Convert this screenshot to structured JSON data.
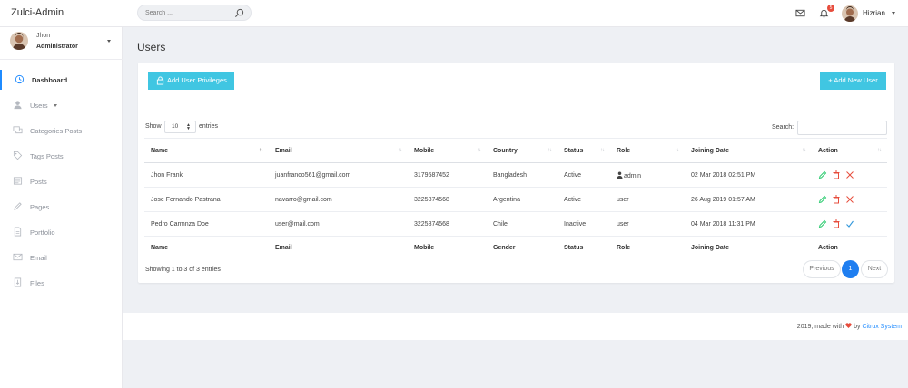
{
  "app": {
    "title": "Zulci-Admin"
  },
  "topbar": {
    "search_placeholder": "Search ...",
    "notification_count": "5",
    "user_name": "Hizrian"
  },
  "sidebar": {
    "profile": {
      "name": "Jhon",
      "role": "Administrator"
    },
    "items": [
      {
        "label": "Dashboard",
        "icon": "clock-icon",
        "active": true
      },
      {
        "label": "Users",
        "icon": "user-icon"
      },
      {
        "label": "Categories Posts",
        "icon": "chat-icon"
      },
      {
        "label": "Tags Posts",
        "icon": "tag-icon"
      },
      {
        "label": "Posts",
        "icon": "posts-icon"
      },
      {
        "label": "Pages",
        "icon": "pencil-icon"
      },
      {
        "label": "Portfolio",
        "icon": "document-icon"
      },
      {
        "label": "Email",
        "icon": "mail-icon"
      },
      {
        "label": "Files",
        "icon": "download-file-icon"
      }
    ]
  },
  "page": {
    "title": "Users"
  },
  "toolbar": {
    "add_privileges": "Add User Privileges",
    "add_user": "+ Add New User"
  },
  "table_controls": {
    "show_label": "Show",
    "page_size": "10",
    "entries_label": "entries",
    "search_label": "Search:"
  },
  "table": {
    "headers": [
      "Name",
      "Email",
      "Mobile",
      "Country",
      "Status",
      "Role",
      "Joining Date",
      "Action"
    ],
    "footers": [
      "Name",
      "Email",
      "Mobile",
      "Gender",
      "Status",
      "Role",
      "Joining Date",
      "Action"
    ],
    "rows": [
      {
        "name": "Jhon Frank",
        "email": "juanfranco561@gmail.com",
        "mobile": "3179587452",
        "country": "Bangladesh",
        "status": "Active",
        "role": "admin",
        "joined": "02 Mar 2018 02:51 PM"
      },
      {
        "name": "Jose Fernando Pastrana",
        "email": "navarro@gmail.com",
        "mobile": "3225874568",
        "country": "Argentina",
        "status": "Active",
        "role": "user",
        "joined": "26 Aug 2019 01:57 AM"
      },
      {
        "name": "Pedro Carmnza Doe",
        "email": "user@mail.com",
        "mobile": "3225874568",
        "country": "Chile",
        "status": "Inactive",
        "role": "user",
        "joined": "04 Mar 2018 11:31 PM"
      }
    ]
  },
  "pagination": {
    "info": "Showing 1 to 3 of 3 entries",
    "prev": "Previous",
    "current": "1",
    "next": "Next"
  },
  "footer": {
    "year_text": "2019, made with",
    "by_text": "by",
    "brand_link": "Citrux System"
  },
  "colors": {
    "accent": "#1f8bff",
    "button_cyan": "#40c6e2",
    "edit_green": "#2ecc71",
    "delete_red": "#e74c3c",
    "confirm_blue": "#3498db"
  }
}
